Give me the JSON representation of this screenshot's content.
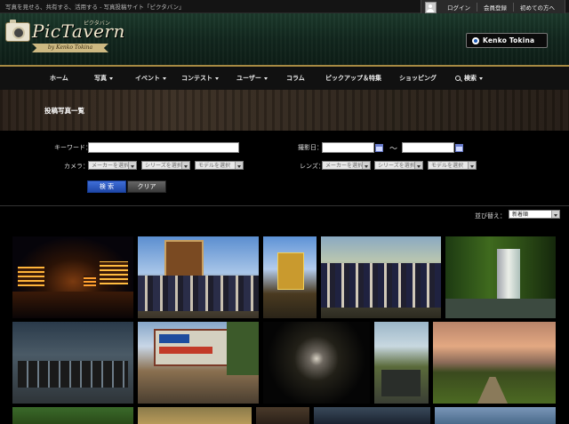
{
  "topbar": {
    "tagline": "写真を見せる、共有する、活用する - 写真投稿サイト「ピクタバン」",
    "links": [
      "ログイン",
      "会員登録",
      "初めての方へ"
    ]
  },
  "header": {
    "logo_text": "PicTavern",
    "logo_kana": "ピクタバン",
    "logo_ribbon": "by Kenko Tokina",
    "sponsor": "Kenko Tokina"
  },
  "nav": {
    "items": [
      {
        "label": "ホーム",
        "caret": false
      },
      {
        "label": "写真",
        "caret": true
      },
      {
        "label": "イベント",
        "caret": true
      },
      {
        "label": "コンテスト",
        "caret": true
      },
      {
        "label": "ユーザー",
        "caret": true
      },
      {
        "label": "コラム",
        "caret": false
      },
      {
        "label": "ピックアップ＆特集",
        "caret": false
      },
      {
        "label": "ショッピング",
        "caret": false
      },
      {
        "label": "検索",
        "caret": true
      }
    ]
  },
  "page": {
    "title": "投稿写真一覧"
  },
  "form": {
    "keyword_label": "キーワード：",
    "keyword_value": "",
    "date_label": "撮影日：",
    "date_separator": "～",
    "date_from": "",
    "date_to": "",
    "camera_label": "カメラ：",
    "lens_label": "レンズ：",
    "camera_selects": [
      "メーカーを選択",
      "シリーズを選択",
      "モデルを選択"
    ],
    "lens_selects": [
      "メーカーを選択",
      "シリーズを選択",
      "モデルを選択"
    ],
    "search_button": "検 索",
    "clear_button": "クリア"
  },
  "sort": {
    "label": "並び替え：",
    "value": "新着順"
  }
}
